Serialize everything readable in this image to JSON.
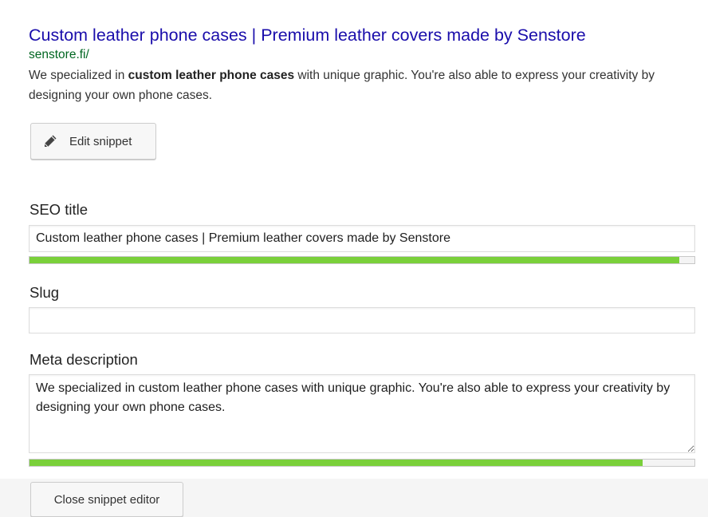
{
  "preview": {
    "title": "Custom leather phone cases | Premium leather covers made by Senstore",
    "url": "senstore.fi/",
    "description_before": "We specialized in ",
    "description_bold": "custom leather phone cases",
    "description_after": " with unique graphic. You're also able to express your creativity by designing your own phone cases."
  },
  "buttons": {
    "edit_label": "Edit snippet",
    "edit_icon": "pencil-icon",
    "close_label": "Close snippet editor"
  },
  "form": {
    "seo_title": {
      "label": "SEO title",
      "value": "Custom leather phone cases | Premium leather covers made by Senstore",
      "progress_fraction": 0.977
    },
    "slug": {
      "label": "Slug",
      "value": ""
    },
    "meta_description": {
      "label": "Meta description",
      "value": "We specialized in custom leather phone cases with unique graphic. You're also able to express your creativity by designing your own phone cases.",
      "progress_fraction": 0.922
    }
  },
  "colors": {
    "title_link": "#1a0dab",
    "url_green": "#006621",
    "progress_good": "#7ad03a"
  }
}
